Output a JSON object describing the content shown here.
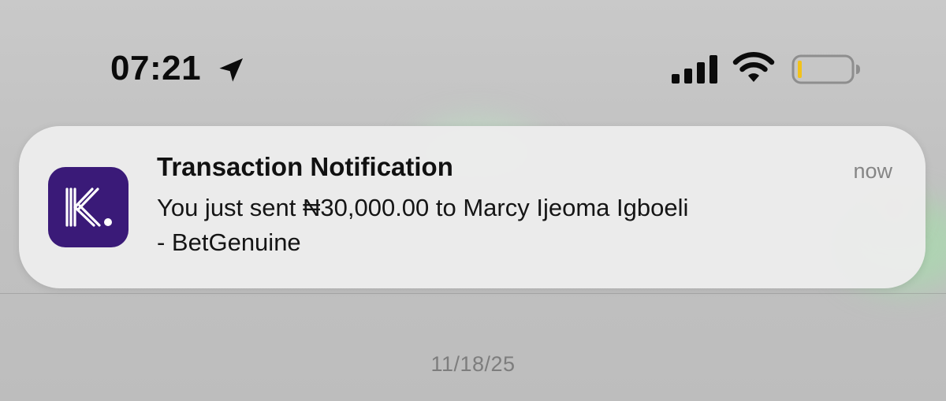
{
  "status_bar": {
    "time": "07:21",
    "icons": [
      "location-arrow-icon",
      "cellular-signal-icon",
      "wifi-icon",
      "battery-low-icon"
    ]
  },
  "notification": {
    "app_icon": "kuda-k-logo-icon",
    "title": "Transaction Notification",
    "time": "now",
    "body_line1": "You just sent ₦30,000.00 to Marcy Ijeoma Igboeli",
    "body_line2": "- BetGenuine"
  },
  "background": {
    "date": "11/18/25"
  },
  "colors": {
    "app_icon_bg": "#3a1a78",
    "battery_low": "#f2c21a",
    "notification_bg": "#ececec"
  }
}
